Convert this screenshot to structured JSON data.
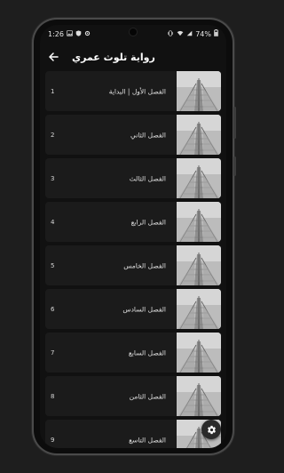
{
  "status": {
    "time": "1:26",
    "battery": "74%",
    "icons": [
      "image-icon",
      "shield-icon",
      "settings-icon",
      "vibrate-icon",
      "wifi-icon",
      "signal-icon",
      "battery-icon"
    ]
  },
  "appbar": {
    "title": "رواية تلوث عمري",
    "back_icon": "arrow-left-icon"
  },
  "chapters": [
    {
      "num": "1",
      "title": "الفصل الأول | البداية"
    },
    {
      "num": "2",
      "title": "الفصل الثاني"
    },
    {
      "num": "3",
      "title": "الفصل الثالث"
    },
    {
      "num": "4",
      "title": "الفصل الرابع"
    },
    {
      "num": "5",
      "title": "الفصل الخامس"
    },
    {
      "num": "6",
      "title": "الفصل السادس"
    },
    {
      "num": "7",
      "title": "الفصل السابع"
    },
    {
      "num": "8",
      "title": "الفصل الثامن"
    },
    {
      "num": "9",
      "title": "الفصل التاسع"
    }
  ],
  "fab": {
    "icon": "gear-icon"
  }
}
